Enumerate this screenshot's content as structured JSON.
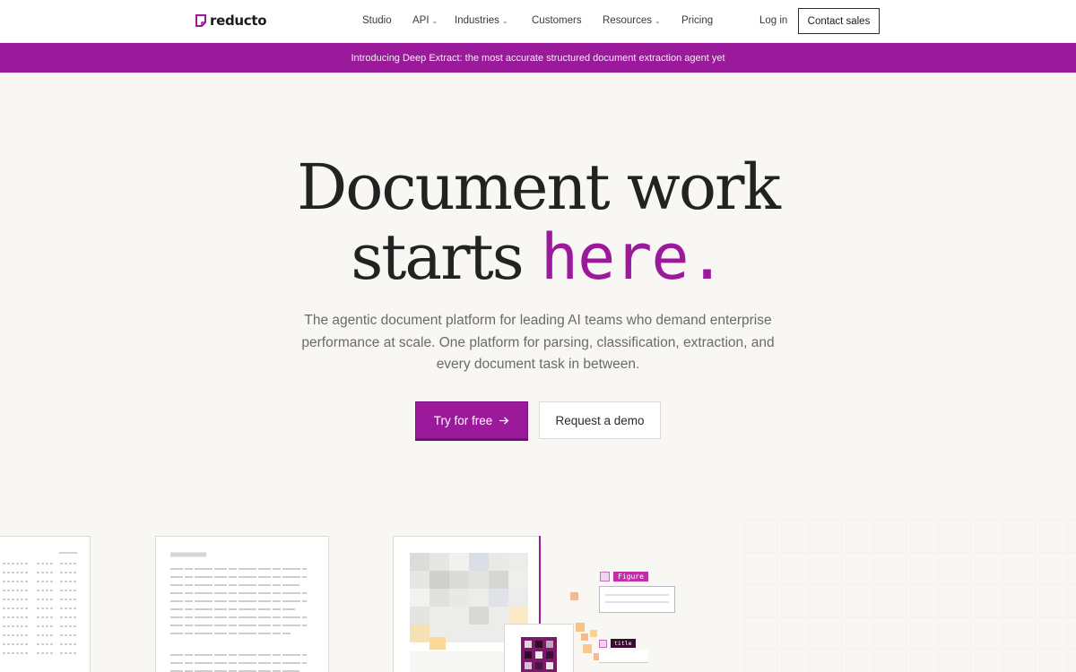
{
  "brand": {
    "name": "reducto",
    "accent_color": "#9a1a9b"
  },
  "nav": {
    "items": [
      {
        "label": "Studio",
        "has_dropdown": false
      },
      {
        "label": "API",
        "has_dropdown": true
      },
      {
        "label": "Industries",
        "has_dropdown": true
      },
      {
        "label": "Customers",
        "has_dropdown": false
      },
      {
        "label": "Resources",
        "has_dropdown": true
      },
      {
        "label": "Pricing",
        "has_dropdown": false
      }
    ],
    "login_label": "Log in",
    "contact_label": "Contact sales"
  },
  "banner": {
    "text": "Introducing Deep Extract: the most accurate structured document extraction agent yet"
  },
  "hero": {
    "title_line1": "Document work",
    "title_line2_plain": "starts ",
    "title_line2_accent": "here.",
    "subtitle": "The agentic document platform for leading AI teams who demand enterprise performance at scale. One platform for parsing, classification, extraction, and every document task in between.",
    "primary_cta": "Try for free",
    "primary_cta_icon": "arrow-right-icon",
    "secondary_cta": "Request a demo"
  },
  "illustration": {
    "figure_tag": "Figure",
    "title_tag": "title"
  }
}
